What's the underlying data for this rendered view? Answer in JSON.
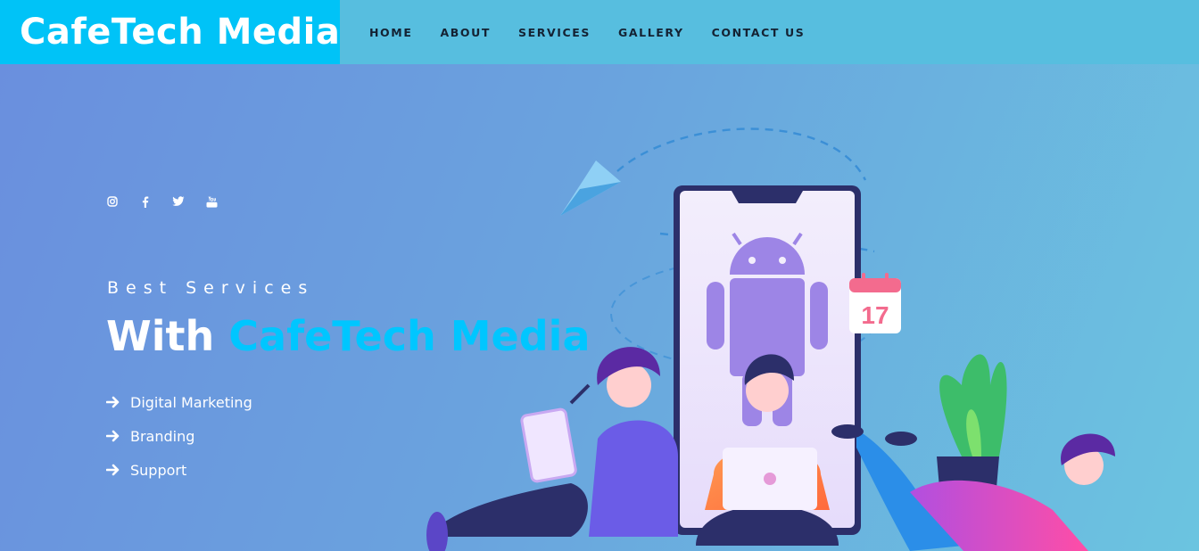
{
  "header": {
    "brand": "CafeTech Media",
    "nav": [
      {
        "label": "HOME"
      },
      {
        "label": "ABOUT"
      },
      {
        "label": "SERVICES"
      },
      {
        "label": "GALLERY"
      },
      {
        "label": "CONTACT US"
      }
    ]
  },
  "hero": {
    "social_icons": [
      "instagram-icon",
      "facebook-icon",
      "twitter-icon",
      "youtube-icon"
    ],
    "eyebrow": "Best Services",
    "headline_prefix": "With",
    "headline_brand": "CafeTech Media",
    "features": [
      {
        "label": "Digital Marketing",
        "icon": "arrow-right-icon"
      },
      {
        "label": "Branding",
        "icon": "arrow-right-icon"
      },
      {
        "label": "Support",
        "icon": "arrow-right-icon"
      }
    ],
    "calendar_day": "17"
  },
  "colors": {
    "accent": "#00c3f7",
    "header_bg": "#57bedf",
    "nav_text": "#142233"
  }
}
